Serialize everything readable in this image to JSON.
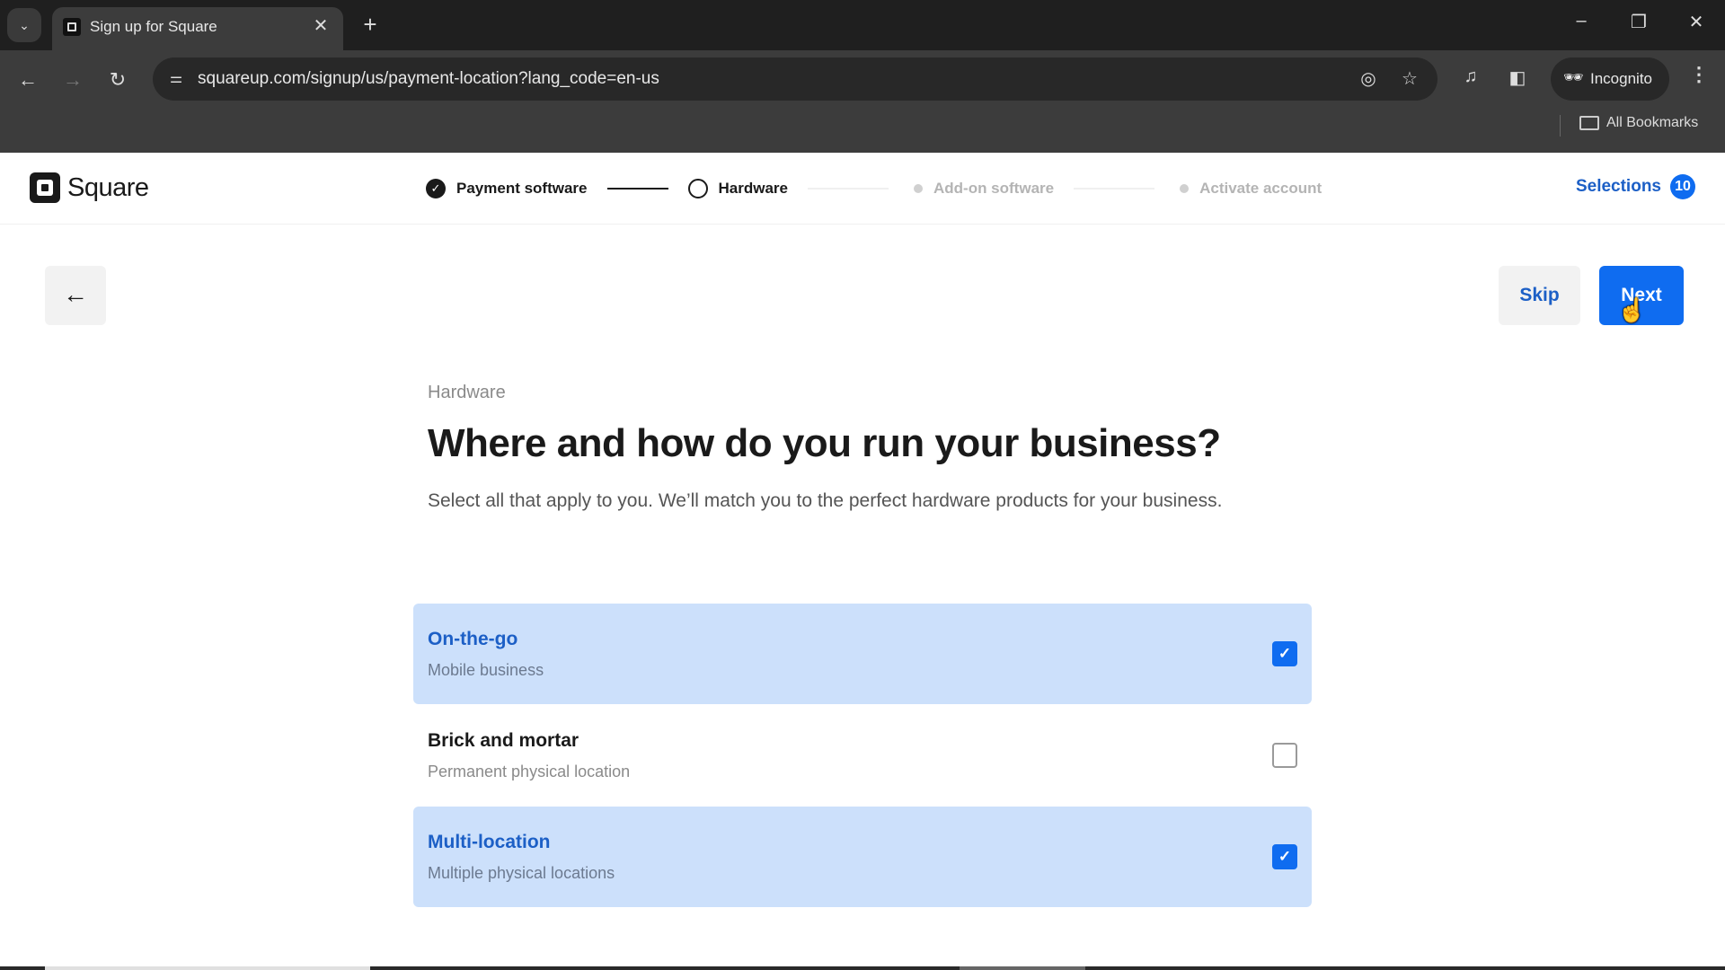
{
  "browser": {
    "tab_title": "Sign up for Square",
    "url": "squareup.com/signup/us/payment-location?lang_code=en-us",
    "incognito_label": "Incognito",
    "bookmarks_label": "All Bookmarks",
    "icons": {
      "tab_search": "chevron-down-icon",
      "tab_close": "close-icon",
      "new_tab": "plus-icon",
      "back": "arrow-left-icon",
      "forward": "arrow-right-icon",
      "reload": "reload-icon",
      "site_info": "tune-icon",
      "eye_off": "eye-off-icon",
      "star": "star-icon",
      "media": "media-queue-icon",
      "side_panel": "side-panel-icon",
      "incognito": "incognito-icon",
      "menu": "kebab-menu-icon"
    },
    "glyphs": {
      "tab_search": "⌄",
      "tab_close": "✕",
      "new_tab": "+",
      "minimize": "–",
      "restore": "❐",
      "close": "✕",
      "back": "←",
      "forward": "→",
      "reload": "↻",
      "site_info": "⚌",
      "eye_off": "◎",
      "star": "☆",
      "media": "♫",
      "side_panel": "◧",
      "incognito": "🕶",
      "menu": "⋮"
    }
  },
  "header": {
    "brand": "Square",
    "steps": [
      {
        "label": "Payment software",
        "state": "done",
        "glyph": "✓"
      },
      {
        "label": "Hardware",
        "state": "current"
      },
      {
        "label": "Add-on software",
        "state": "future"
      },
      {
        "label": "Activate account",
        "state": "future"
      }
    ],
    "selections_label": "Selections",
    "selections_count": "10"
  },
  "actions": {
    "back_glyph": "←",
    "skip_label": "Skip",
    "next_label": "Next",
    "cursor_glyph": "☝"
  },
  "main": {
    "eyebrow": "Hardware",
    "headline": "Where and how do you run your business?",
    "description": "Select all that apply to you. We’ll match you to the perfect hardware products for your business.",
    "options": [
      {
        "title": "On-the-go",
        "subtitle": "Mobile business",
        "checked": true,
        "check_glyph": "✓"
      },
      {
        "title": "Brick and mortar",
        "subtitle": "Permanent physical location",
        "checked": false,
        "check_glyph": ""
      },
      {
        "title": "Multi-location",
        "subtitle": "Multiple physical locations",
        "checked": true,
        "check_glyph": "✓"
      }
    ]
  },
  "colors": {
    "accent": "#0f6cf0",
    "accent_text": "#1c5fc6",
    "selected_bg": "#cce0fb"
  }
}
